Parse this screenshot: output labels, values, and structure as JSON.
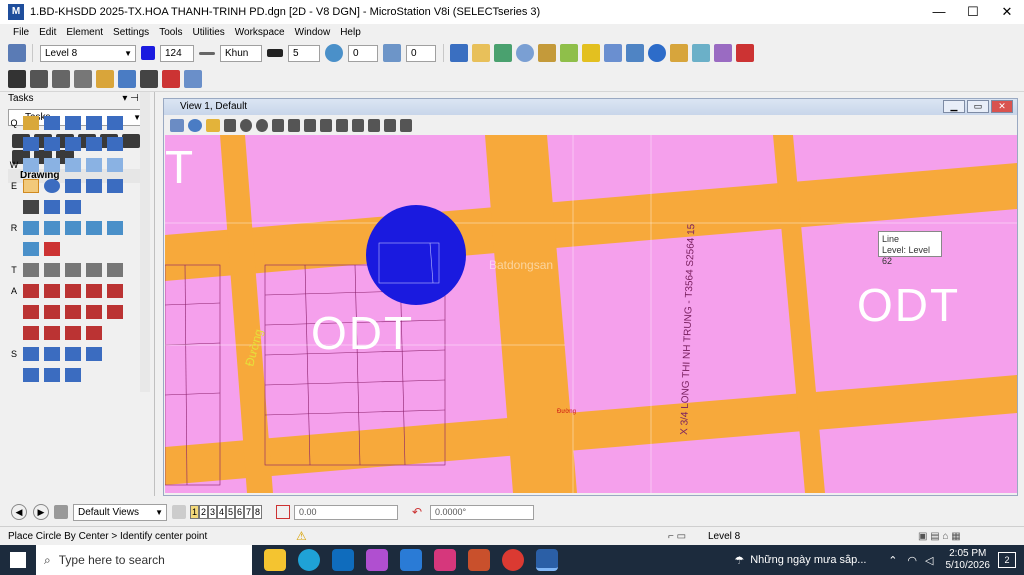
{
  "window": {
    "title": "1.BD-KHSDD 2025-TX.HOA THANH-TRINH PD.dgn [2D - V8 DGN] - MicroStation V8i (SELECTseries 3)",
    "minimize": "—",
    "maximize": "☐",
    "close": "✕"
  },
  "menu": [
    "File",
    "Edit",
    "Element",
    "Settings",
    "Tools",
    "Utilities",
    "Workspace",
    "Window",
    "Help"
  ],
  "attributes": {
    "level": "Level 8",
    "color": "124",
    "style": "Khun",
    "weight": "5",
    "transparency": "0",
    "priority": "0"
  },
  "tasks_panel": {
    "header": "Tasks",
    "selected": "Tasks",
    "drawing_header": "Drawing",
    "row_letters": [
      "Q",
      "W",
      "E",
      "R",
      "T",
      "A",
      "S"
    ]
  },
  "view": {
    "title": "View 1, Default"
  },
  "canvas_labels": {
    "odt_left": "ODT",
    "odt_right": "ODT",
    "top_left": "T",
    "watermark": "Batdongsan",
    "road_name": "X 3/4 LONG THI NH TRUNG - T3564 S2564 15",
    "road_small": "Đường"
  },
  "tooltip": {
    "line1": "Line",
    "line2": "Level: Level 62"
  },
  "bottom": {
    "view_group": "Default Views",
    "views": [
      "1",
      "2",
      "3",
      "4",
      "5",
      "6",
      "7",
      "8"
    ],
    "active_view": "1",
    "distance": "0.00",
    "angle": "0.0000°"
  },
  "status": {
    "prompt": "Place Circle By Center > Identify center point",
    "level": "Level 8"
  },
  "taskbar": {
    "search_placeholder": "Type here to search",
    "weather": "Những ngày mưa sắp...",
    "time": "2:05 PM",
    "date": "5/10/2026",
    "notifications": "2"
  },
  "colors": {
    "zone": "#f5a0ec",
    "road": "#f7a93b",
    "circle": "#1a1adf",
    "titlebar": "#ffffff"
  }
}
